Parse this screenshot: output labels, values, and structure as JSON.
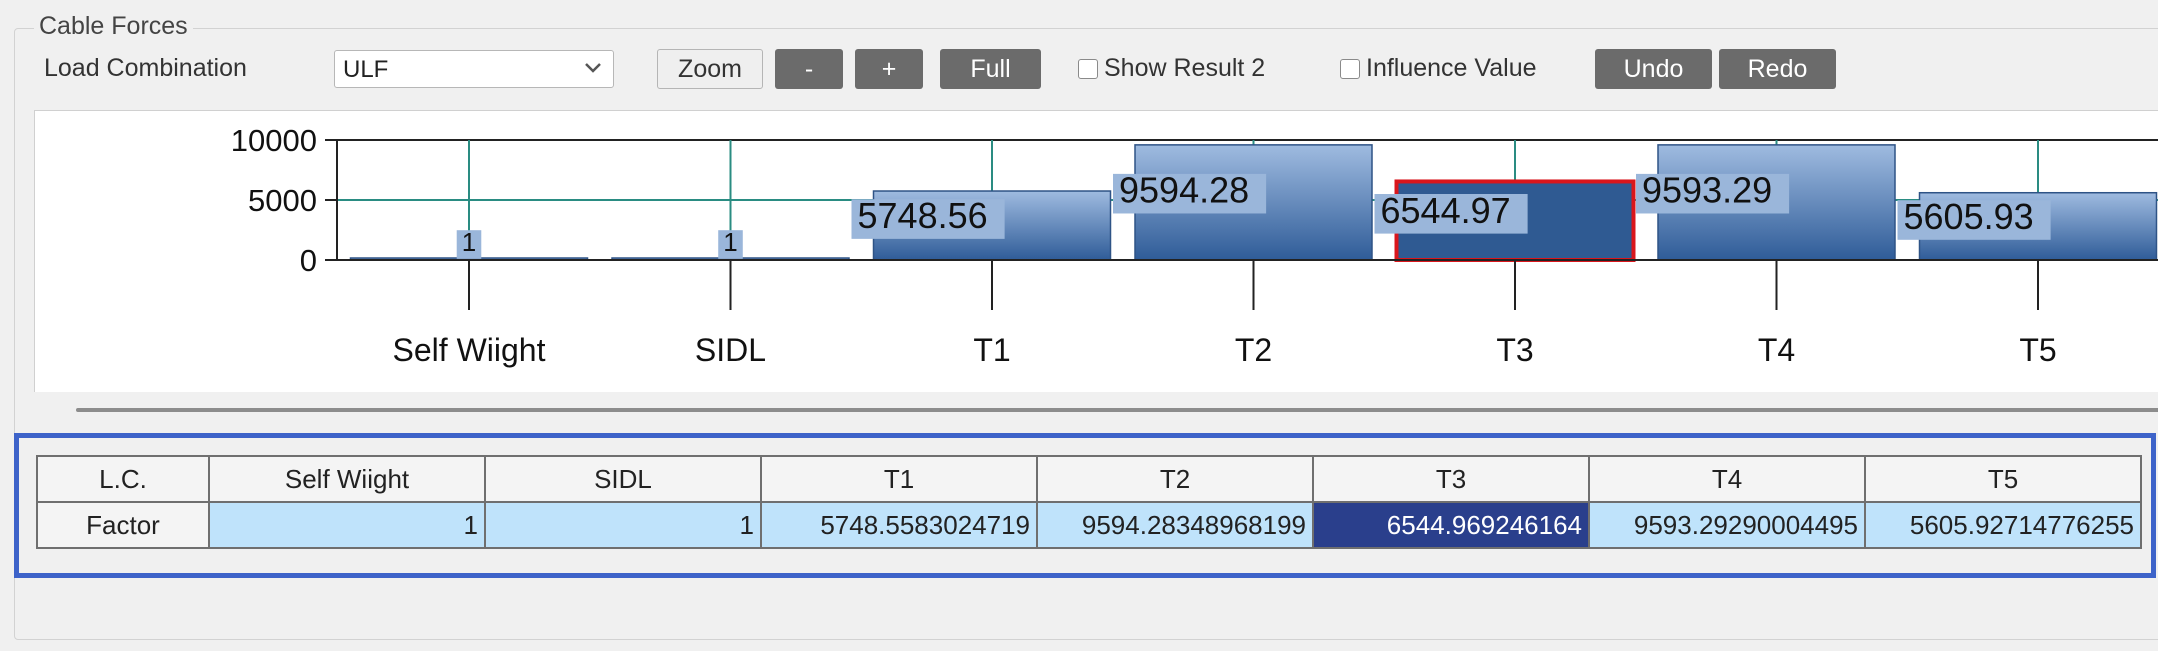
{
  "panel": {
    "title": "Cable Forces",
    "load_combination_label": "Load Combination",
    "load_combination_value": "ULF"
  },
  "toolbar": {
    "zoom": "Zoom",
    "minus": "-",
    "plus": "+",
    "full": "Full",
    "show_result_2": "Show Result 2",
    "show_result_2_checked": false,
    "influence_value": "Influence Value",
    "influence_value_checked": false,
    "undo": "Undo",
    "redo": "Redo"
  },
  "chart_data": {
    "type": "bar",
    "categories": [
      "Self Wiight",
      "SIDL",
      "T1",
      "T2",
      "T3",
      "T4",
      "T5"
    ],
    "values": [
      1,
      1,
      5748.56,
      9594.28,
      6544.97,
      9593.29,
      5605.93
    ],
    "value_labels": [
      "1",
      "1",
      "5748.56",
      "9594.28",
      "6544.97",
      "9593.29",
      "5605.93"
    ],
    "yticks": [
      "10000",
      "5000",
      "0"
    ],
    "ylim": [
      0,
      10000
    ],
    "selected_index": 4,
    "grid": true,
    "colors": {
      "bar": "#3f6aa3",
      "bar_light": "#9fbbe0",
      "selected_border": "#d9161c",
      "grid": "#2a8c82",
      "label_bg": "#9ab6da"
    }
  },
  "table": {
    "corner": "L.C.",
    "columns": [
      "Self Wiight",
      "SIDL",
      "T1",
      "T2",
      "T3",
      "T4",
      "T5"
    ],
    "row_label": "Factor",
    "values": [
      "1",
      "1",
      "5748.5583024719",
      "9594.28348968199",
      "6544.969246164",
      "9593.29290004495",
      "5605.92714776255"
    ],
    "selected_col": 4
  }
}
